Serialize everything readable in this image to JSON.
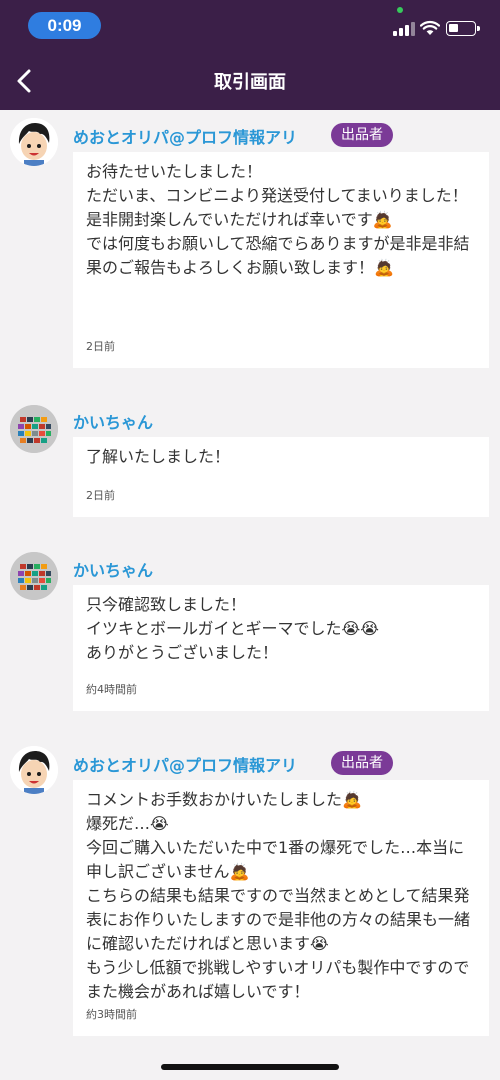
{
  "status_bar": {
    "time": "0:09"
  },
  "header": {
    "title": "取引画面"
  },
  "messages": [
    {
      "sender": "めおとオリパ@プロフ情報アリ",
      "badge": "出品者",
      "text": "お待たせいたしました！\nただいま、コンビニより発送受付してまいりました！\n是非開封楽しんでいただければ幸いです🙇\nでは何度もお願いして恐縮でらありますが是非是非結果のご報告もよろしくお願い致します！🙇",
      "time": "2日前"
    },
    {
      "sender": "かいちゃん",
      "text": "了解いたしました！",
      "time": "2日前"
    },
    {
      "sender": "かいちゃん",
      "text": "只今確認致しました！\nイツキとボールガイとギーマでした😭😭\nありがとうございました！",
      "time": "約4時間前"
    },
    {
      "sender": "めおとオリパ@プロフ情報アリ",
      "badge": "出品者",
      "text": "コメントお手数おかけいたしました🙇\n爆死だ…😭\n今回ご購入いただいた中で1番の爆死でした…本当に申し訳ございません🙇\nこちらの結果も結果ですので当然まとめとして結果発表にお作りいたしますので是非他の方々の結果も一緒に確認いただければと思います😭\nもう少し低額で挑戦しやすいオリパも製作中ですのでまた機会があれば嬉しいです！",
      "time": "約3時間前"
    }
  ]
}
